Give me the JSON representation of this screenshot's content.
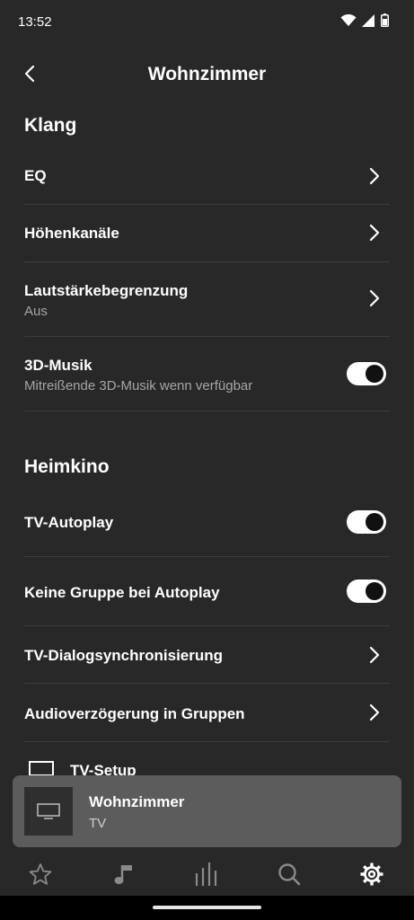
{
  "status_bar": {
    "time": "13:52"
  },
  "header": {
    "title": "Wohnzimmer"
  },
  "sections": {
    "klang": {
      "title": "Klang",
      "eq": {
        "label": "EQ"
      },
      "hoehenkanaele": {
        "label": "Höhenkanäle"
      },
      "lautstaerke": {
        "label": "Lautstärkebegrenzung",
        "sub": "Aus"
      },
      "musik3d": {
        "label": "3D-Musik",
        "sub": "Mitreißende 3D-Musik wenn verfügbar",
        "on": true
      }
    },
    "heimkino": {
      "title": "Heimkino",
      "tv_autoplay": {
        "label": "TV-Autoplay",
        "on": true
      },
      "keine_gruppe": {
        "label": "Keine Gruppe bei Autoplay",
        "on": true
      },
      "dialog_sync": {
        "label": "TV-Dialogsynchronisierung"
      },
      "audio_delay": {
        "label": "Audioverzögerung in Gruppen"
      },
      "tv_setup": {
        "label": "TV-Setup",
        "icon": "tv-icon"
      }
    }
  },
  "now_playing": {
    "title": "Wohnzimmer",
    "subtitle": "TV",
    "icon": "tv-icon"
  },
  "bottom_nav": {
    "items": [
      "star-icon",
      "music-note-icon",
      "equalizer-icon",
      "search-icon",
      "gear-icon"
    ],
    "active": "gear-icon"
  },
  "colors": {
    "background": "#282828",
    "divider": "#3d3d3d",
    "secondary_text": "#a6a6a6",
    "mini_player": "#5c5c5c"
  }
}
